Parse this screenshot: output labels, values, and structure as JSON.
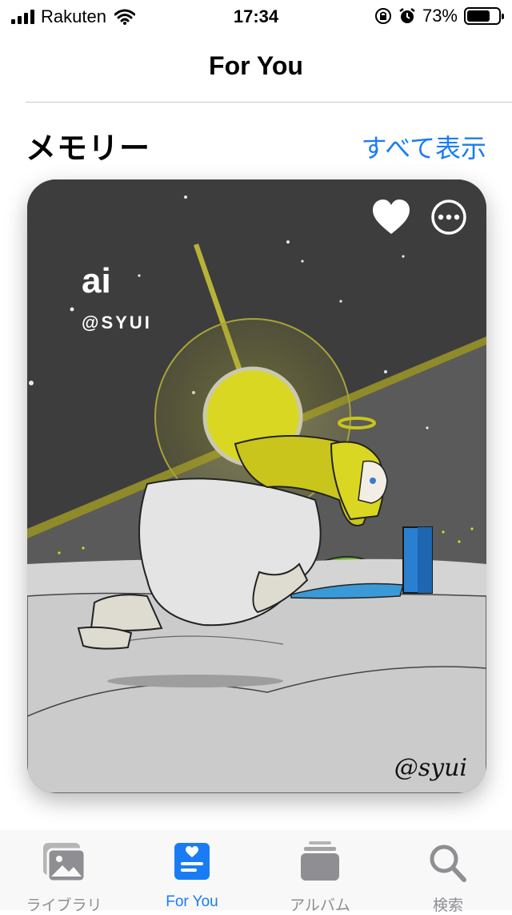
{
  "status_bar": {
    "carrier": "Rakuten",
    "time": "17:34",
    "battery": "73%",
    "battery_level": 0.73
  },
  "nav": {
    "title": "For You"
  },
  "memories": {
    "section_title": "メモリー",
    "see_all_label": "すべて表示",
    "card": {
      "title": "ai",
      "subtitle": "@SYUI",
      "signature": "@syui",
      "favorite_icon": "heart-icon",
      "more_icon": "ellipsis-circle-icon"
    }
  },
  "tab_bar": {
    "tabs": [
      {
        "label": "ライブラリ",
        "icon": "photo-library-icon",
        "active": false
      },
      {
        "label": "For You",
        "icon": "for-you-icon",
        "active": true
      },
      {
        "label": "アルバム",
        "icon": "albums-icon",
        "active": false
      },
      {
        "label": "検索",
        "icon": "search-icon",
        "active": false
      }
    ]
  },
  "colors": {
    "accent": "#1a7cf5",
    "inactive": "#8e8e93"
  }
}
